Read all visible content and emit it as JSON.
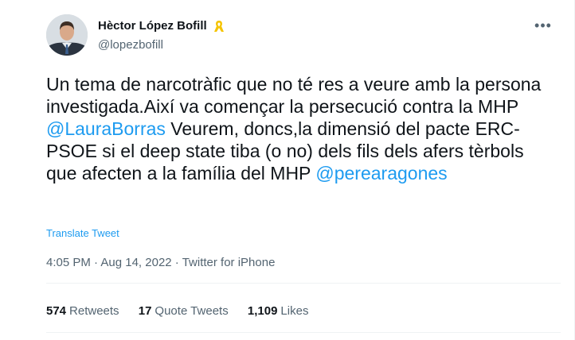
{
  "author": {
    "display_name": "Hèctor López Bofill",
    "handle": "@lopezbofill",
    "badge_icon": "yellow-ribbon-icon"
  },
  "tweet": {
    "text_segments": [
      {
        "text": "Un tema de narcotràfic que no té res a veure amb la persona investigada.Així va començar la persecució contra la MHP ",
        "mention": false
      },
      {
        "text": "@LauraBorras",
        "mention": true
      },
      {
        "text": " Veurem, doncs,la dimensió del pacte ERC-PSOE si el deep state tiba (o no) dels fils dels afers tèrbols que afecten a la família del MHP ",
        "mention": false
      },
      {
        "text": "@perearagones",
        "mention": true
      }
    ],
    "translate_label": "Translate Tweet"
  },
  "meta": {
    "time": "4:05 PM",
    "separator": " · ",
    "date": "Aug 14, 2022",
    "source": "Twitter for iPhone"
  },
  "stats": {
    "retweets_count": "574",
    "retweets_label": "Retweets",
    "quotes_count": "17",
    "quotes_label": "Quote Tweets",
    "likes_count": "1,109",
    "likes_label": "Likes"
  },
  "more_icon": "more-icon",
  "colors": {
    "text": "#0f1419",
    "secondary": "#536471",
    "link": "#1d9bf0",
    "ribbon": "#f5c400"
  }
}
